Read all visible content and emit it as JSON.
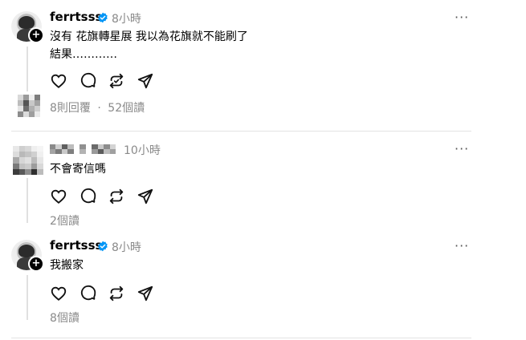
{
  "posts": [
    {
      "username": "ferrtsss",
      "verified": true,
      "time": "8小時",
      "lines": [
        "沒有 花旗轉星展 我以為花旗就不能刷了",
        "結果…………"
      ],
      "meta": "8則回覆",
      "meta_sep": "·",
      "views": "52個讀"
    },
    {
      "username": "",
      "verified": false,
      "time": "10小時",
      "lines": [
        "不會寄信嗎"
      ],
      "meta": "2個讀"
    },
    {
      "username": "ferrtsss",
      "verified": true,
      "time": "8小時",
      "lines": [
        "我搬家"
      ],
      "meta": "8個讀"
    }
  ],
  "more_label": "···",
  "colors": {
    "verified": "#0095f6",
    "muted": "#8a8a8a",
    "divider": "#e3e3e3"
  },
  "icons": [
    "heart-icon",
    "comment-icon",
    "repost-icon",
    "share-icon",
    "more-icon",
    "plus-icon",
    "verified-icon"
  ]
}
